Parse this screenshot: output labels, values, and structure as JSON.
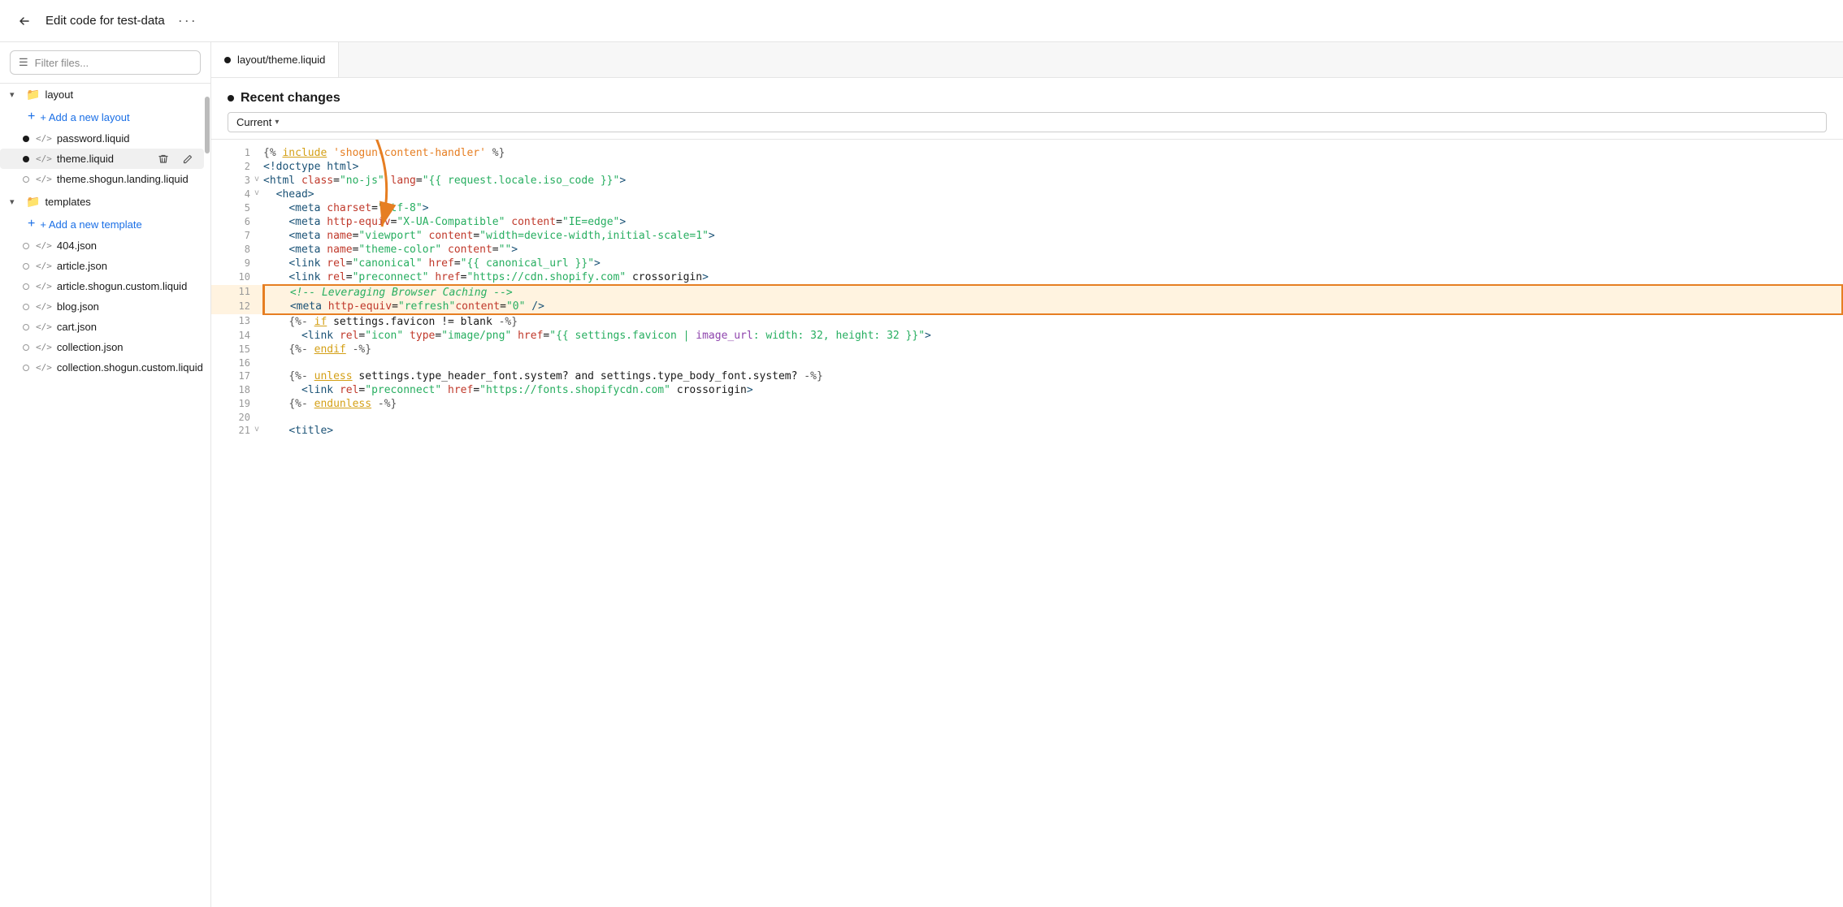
{
  "topbar": {
    "title": "Edit code for test-data",
    "more_label": "···",
    "back_icon": "←"
  },
  "sidebar": {
    "filter_placeholder": "Filter files...",
    "layout_folder": "layout",
    "add_layout_label": "+ Add a new layout",
    "layout_files": [
      {
        "name": "password.liquid",
        "dot": "filled",
        "tag": "</>"
      },
      {
        "name": "theme.liquid",
        "dot": "filled",
        "tag": "</>",
        "active": true
      }
    ],
    "theme_shogun": {
      "name": "theme.shogun.landing.liquid",
      "dot": "empty",
      "tag": "</>"
    },
    "templates_folder": "templates",
    "add_template_label": "+ Add a new template",
    "template_files": [
      {
        "name": "404.json",
        "dot": "empty",
        "tag": "</>"
      },
      {
        "name": "article.json",
        "dot": "empty",
        "tag": "</>"
      },
      {
        "name": "article.shogun.custom.liquid",
        "dot": "empty",
        "tag": "</>"
      },
      {
        "name": "blog.json",
        "dot": "empty",
        "tag": "</>"
      },
      {
        "name": "cart.json",
        "dot": "empty",
        "tag": "</>"
      },
      {
        "name": "collection.json",
        "dot": "empty",
        "tag": "</>"
      },
      {
        "name": "collection.shogun.custom.liquid",
        "dot": "empty",
        "tag": "</>"
      }
    ]
  },
  "editor": {
    "tab_label": "layout/theme.liquid",
    "tab_dot": true,
    "recent_changes_title": "Recent changes",
    "current_label": "Current"
  },
  "code": {
    "lines": [
      {
        "num": 1,
        "ver": "",
        "content": "{% include 'shogun-content-handler' %}"
      },
      {
        "num": 2,
        "ver": "",
        "content": "<!doctype html>"
      },
      {
        "num": 3,
        "ver": "v",
        "content": "<html class=\"no-js\" lang=\"{{ request.locale.iso_code }}\">"
      },
      {
        "num": 4,
        "ver": "v",
        "content": "  <head>"
      },
      {
        "num": 5,
        "ver": "",
        "content": "    <meta charset=\"utf-8\">"
      },
      {
        "num": 6,
        "ver": "",
        "content": "    <meta http-equiv=\"X-UA-Compatible\" content=\"IE=edge\">"
      },
      {
        "num": 7,
        "ver": "",
        "content": "    <meta name=\"viewport\" content=\"width=device-width,initial-scale=1\">"
      },
      {
        "num": 8,
        "ver": "",
        "content": "    <meta name=\"theme-color\" content=\"\">"
      },
      {
        "num": 9,
        "ver": "",
        "content": "    <link rel=\"canonical\" href=\"{{ canonical_url }}\">"
      },
      {
        "num": 10,
        "ver": "",
        "content": "    <link rel=\"preconnect\" href=\"https://cdn.shopify.com\" crossorigin>"
      },
      {
        "num": 11,
        "ver": "",
        "content": "    <!-- Leveraging Browser Caching -->"
      },
      {
        "num": 12,
        "ver": "",
        "content": "    <meta http-equiv=\"refresh\"content=\"0\" />"
      },
      {
        "num": 13,
        "ver": "",
        "content": "    {%- if settings.favicon != blank -%}"
      },
      {
        "num": 14,
        "ver": "",
        "content": "      <link rel=\"icon\" type=\"image/png\" href=\"{{ settings.favicon | image_url: width: 32, height: 32 }}\">"
      },
      {
        "num": 15,
        "ver": "",
        "content": "    {%- endif -%}"
      },
      {
        "num": 16,
        "ver": "",
        "content": ""
      },
      {
        "num": 17,
        "ver": "",
        "content": "    {%- unless settings.type_header_font.system? and settings.type_body_font.system? -%}"
      },
      {
        "num": 18,
        "ver": "",
        "content": "      <link rel=\"preconnect\" href=\"https://fonts.shopifycdn.com\" crossorigin>"
      },
      {
        "num": 19,
        "ver": "",
        "content": "    {%- endunless -%}"
      },
      {
        "num": 20,
        "ver": "",
        "content": ""
      },
      {
        "num": 21,
        "ver": "v",
        "content": "    <title>"
      }
    ]
  }
}
